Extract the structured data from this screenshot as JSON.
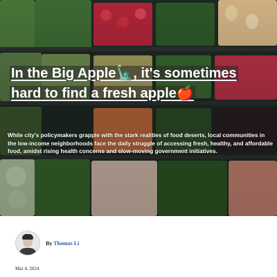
{
  "article": {
    "title_part1": "In the Big Apple",
    "title_emoji1": "🗽",
    "title_part2": ", it's sometimes hard to find a fresh apple",
    "title_emoji2": "🍎",
    "lede": "While city's policymakers grapple with the stark realities of food deserts, local communities in the low-income neighborhoods face the daily struggle of accessing fresh, healthy, and affordable food, amidst rising health concerns and slow-moving government initiatives."
  },
  "author": {
    "by_label": "By",
    "name": "Thomas Li"
  },
  "date": "Mar 4, 2024"
}
